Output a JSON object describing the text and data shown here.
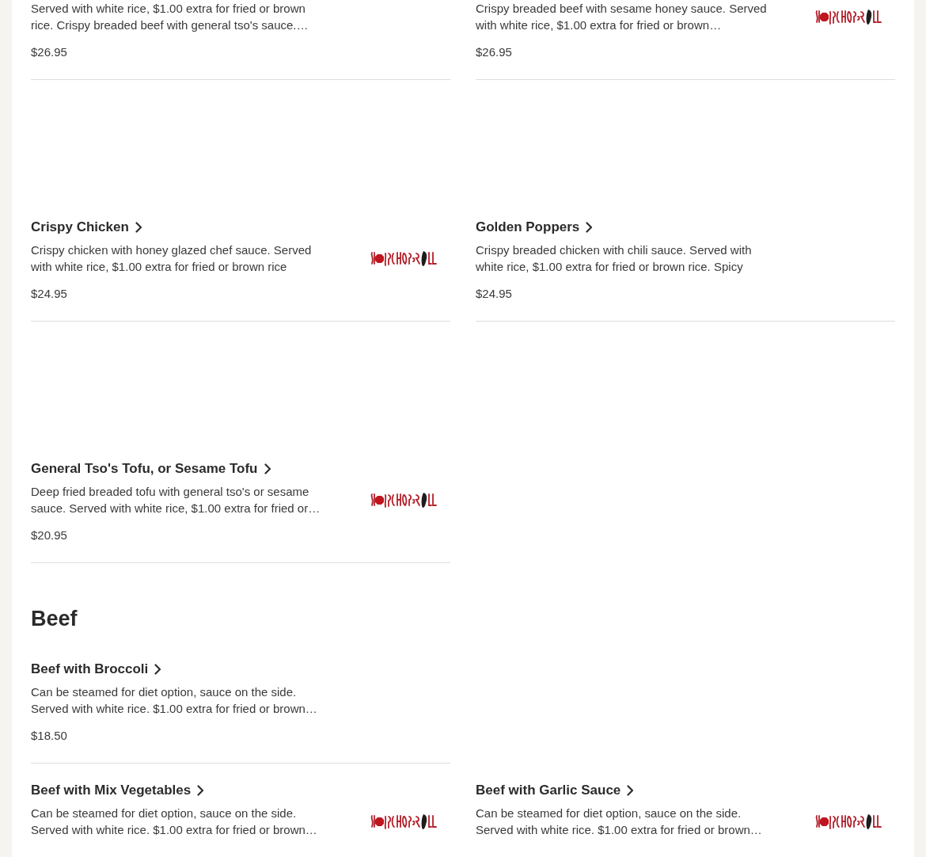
{
  "sections": [
    {
      "rows": [
        [
          {
            "description": "Served with white rice, $1.00 extra for fried or brown rice. Crispy breaded beef with general tso's sauce.…",
            "price": "$26.95"
          },
          {
            "description": "Crispy breaded beef with sesame honey sauce. Served with white rice, $1.00 extra for fried or brown…",
            "price": "$26.95",
            "image": true
          }
        ],
        [
          {
            "title": "Crispy Chicken",
            "description": "Crispy chicken with honey glazed chef sauce. Served with white rice, $1.00 extra for fried or brown rice",
            "price": "$24.95",
            "image": true
          },
          {
            "title": "Golden Poppers",
            "description": "Crispy breaded chicken with chili sauce. Served with white rice, $1.00 extra for fried or brown rice. Spicy",
            "price": "$24.95"
          }
        ],
        [
          {
            "title": "General Tso's Tofu, or Sesame Tofu",
            "description": "Deep fried breaded tofu with general tso's or sesame sauce. Served with white rice, $1.00 extra for fried or…",
            "price": "$20.95",
            "image": true
          }
        ]
      ]
    },
    {
      "heading": "Beef",
      "rows": [
        [
          {
            "title": "Beef with Broccoli",
            "description": "Can be steamed for diet option, sauce on the side. Served with white rice. $1.00 extra for fried or brown…",
            "price": "$18.50"
          }
        ],
        [
          {
            "title": "Beef with Mix Vegetables",
            "description": "Can be steamed for diet option, sauce on the side. Served with white rice. $1.00 extra for fried or brown…",
            "image": true
          },
          {
            "title": "Beef with Garlic Sauce",
            "description": "Can be steamed for diet option, sauce on the side. Served with white rice. $1.00 extra for fried or brown…",
            "image": true
          }
        ]
      ]
    }
  ]
}
